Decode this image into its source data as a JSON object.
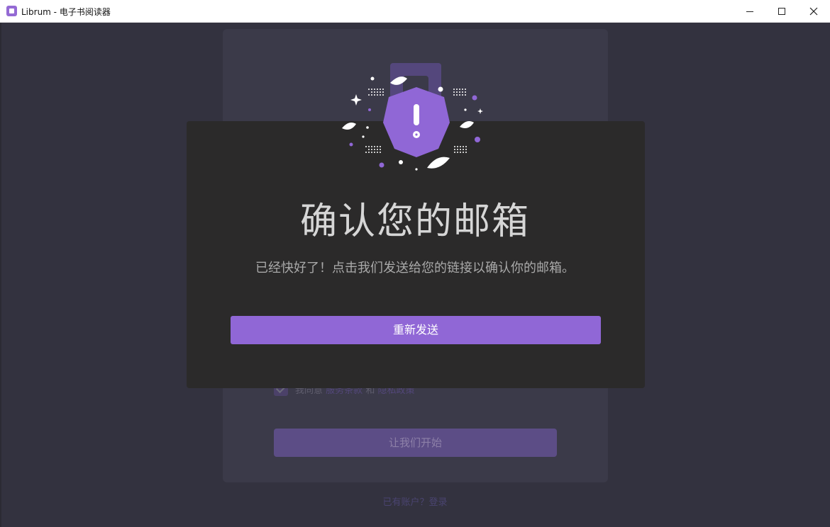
{
  "window": {
    "title": "Librum - 电子书阅读器"
  },
  "background": {
    "agree_prefix": "我同意",
    "terms_link": "服务条款",
    "and": "和",
    "privacy_link": "隐私政策",
    "start_button": "让我们开始",
    "login_prompt": "已有账户？登录"
  },
  "modal": {
    "title": "确认您的邮箱",
    "description": "已经快好了！点击我们发送给您的链接以确认你的邮箱。",
    "resend_button": "重新发送",
    "icon": "warning-hexagon-icon"
  },
  "colors": {
    "accent": "#9067d6",
    "modal_bg": "#2b2a2a",
    "page_bg": "#33323f"
  }
}
